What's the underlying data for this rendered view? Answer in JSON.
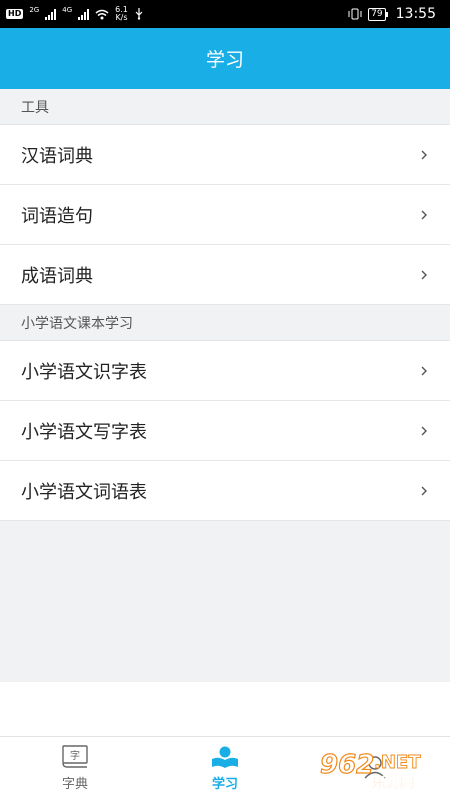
{
  "status_bar": {
    "hd": "HD",
    "gen1": "2G",
    "gen2": "4G",
    "speed_value": "6.1",
    "speed_unit": "K/s",
    "battery": "79",
    "time": "13:55"
  },
  "header": {
    "title": "学习"
  },
  "sections": [
    {
      "title": "工具",
      "items": [
        {
          "label": "汉语词典",
          "icon": "chevron-right-icon"
        },
        {
          "label": "词语造句",
          "icon": "chevron-right-icon"
        },
        {
          "label": "成语词典",
          "icon": "chevron-right-icon"
        }
      ]
    },
    {
      "title": "小学语文课本学习",
      "items": [
        {
          "label": "小学语文识字表",
          "icon": "chevron-right-icon"
        },
        {
          "label": "小学语文写字表",
          "icon": "chevron-right-icon"
        },
        {
          "label": "小学语文词语表",
          "icon": "chevron-right-icon"
        }
      ]
    }
  ],
  "tabbar": {
    "tabs": [
      {
        "label": "字典",
        "icon": "dictionary-icon",
        "active": false
      },
      {
        "label": "学习",
        "icon": "study-icon",
        "active": true
      },
      {
        "label": "",
        "icon": "profile-icon",
        "active": false
      }
    ]
  },
  "watermark": {
    "text_main": "962",
    "text_suffix": ".NET",
    "text_sub": "乐游网"
  },
  "colors": {
    "accent": "#1aaee6",
    "background": "#f1f2f4",
    "watermark_orange": "#f08a1c"
  }
}
